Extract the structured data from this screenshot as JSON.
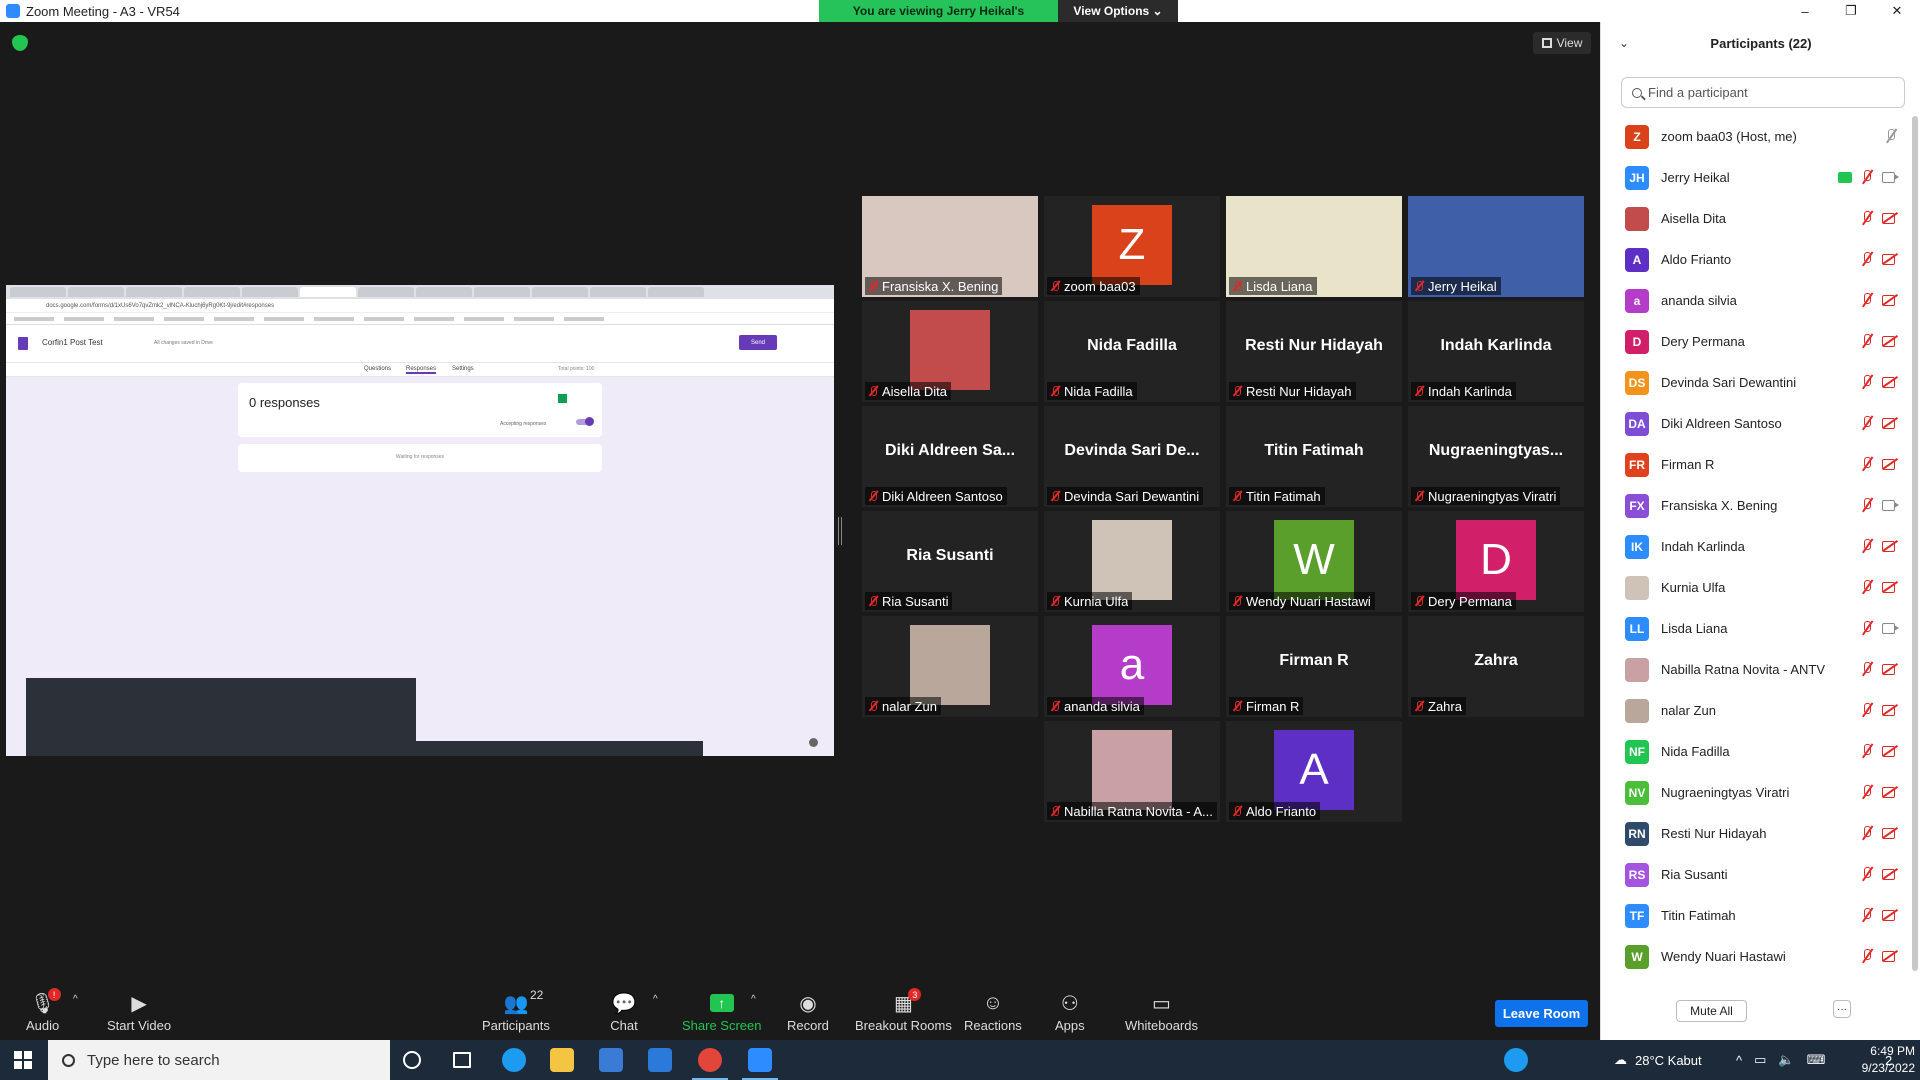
{
  "window": {
    "title": "Zoom Meeting - A3 - VR54",
    "controls": [
      "–",
      "❐",
      "✕"
    ]
  },
  "banner": {
    "viewing": "You are viewing Jerry Heikal's screen",
    "view_options": "View Options ⌄"
  },
  "view_button": "View",
  "shared_screen": {
    "url": "docs.google.com/forms/d/1xUs6Vo7qvZmk2_vlNCA-Kluchj6yRg0Kt-9j/edit#responses",
    "form_title": "Corfin1 Post Test",
    "saved_status": "All changes saved in Drive",
    "send_label": "Send",
    "tabs": [
      "Questions",
      "Responses",
      "Settings"
    ],
    "total_points": "Total points: 100",
    "responses_count": "0 responses",
    "accepting": "Accepting responses",
    "waiting": "Waiting for responses"
  },
  "gallery": [
    {
      "name": "Fransiska X. Bening",
      "display": "photo",
      "photo_color": "#d9c8c0"
    },
    {
      "name": "zoom baa03",
      "display": "avatar",
      "letter": "Z",
      "color": "#d9421a"
    },
    {
      "name": "Lisda Liana",
      "display": "photo",
      "photo_color": "#e9e3c9"
    },
    {
      "name": "Jerry Heikal",
      "display": "photo",
      "photo_color": "#3f5fa8",
      "active": true
    },
    {
      "name": "Aisella Dita",
      "display": "photo",
      "photo_color": "#c24c4c"
    },
    {
      "name": "Nida Fadilla",
      "display": "name",
      "big": "Nida Fadilla"
    },
    {
      "name": "Resti Nur Hidayah",
      "display": "name",
      "big": "Resti Nur Hidayah"
    },
    {
      "name": "Indah Karlinda",
      "display": "name",
      "big": "Indah Karlinda"
    },
    {
      "name": "Diki Aldreen Santoso",
      "display": "name",
      "big": "Diki Aldreen Sa..."
    },
    {
      "name": "Devinda Sari Dewantini",
      "display": "name",
      "big": "Devinda Sari De..."
    },
    {
      "name": "Titin Fatimah",
      "display": "name",
      "big": "Titin Fatimah"
    },
    {
      "name": "Nugraeningtyas Viratri",
      "display": "name",
      "big": "Nugraeningtyas..."
    },
    {
      "name": "Ria Susanti",
      "display": "name",
      "big": "Ria Susanti"
    },
    {
      "name": "Kurnia Ulfa",
      "display": "photo",
      "photo_color": "#cfc3b8"
    },
    {
      "name": "Wendy Nuari Hastawi",
      "display": "avatar",
      "letter": "W",
      "color": "#5a9e2c"
    },
    {
      "name": "Dery Permana",
      "display": "avatar",
      "letter": "D",
      "color": "#d11f6a"
    },
    {
      "name": "nalar Zun",
      "display": "photo",
      "photo_color": "#b8a79a"
    },
    {
      "name": "ananda silvia",
      "display": "avatar",
      "letter": "a",
      "color": "#b53cc8"
    },
    {
      "name": "Firman R",
      "display": "name",
      "big": "Firman R"
    },
    {
      "name": "Zahra",
      "display": "name",
      "big": "Zahra"
    },
    {
      "name": "Nabilla Ratna Novita - A...",
      "display": "photo",
      "photo_color": "#c9a0a4"
    },
    {
      "name": "Aldo Frianto",
      "display": "avatar",
      "letter": "A",
      "color": "#5e2fc4"
    }
  ],
  "toolbar": {
    "audio": "Audio",
    "start_video": "Start Video",
    "participants": "Participants",
    "participants_count": "22",
    "chat": "Chat",
    "share_screen": "Share Screen",
    "record": "Record",
    "breakout_rooms": "Breakout Rooms",
    "breakout_badge": "3",
    "reactions": "Reactions",
    "apps": "Apps",
    "whiteboards": "Whiteboards",
    "audio_badge": "!",
    "leave": "Leave Room"
  },
  "panel": {
    "title": "Participants (22)",
    "search_placeholder": "Find a participant",
    "mute_all": "Mute All",
    "more": "···",
    "participants": [
      {
        "initials": "Z",
        "name": "zoom baa03 (Host, me)",
        "color": "#d9421a",
        "mic": "off",
        "cam": "none"
      },
      {
        "initials": "JH",
        "name": "Jerry Heikal",
        "color": "#2d8cff",
        "mic": "off",
        "cam": "on",
        "sharing": true
      },
      {
        "initials": "",
        "name": "Aisella Dita",
        "color": "#c24c4c",
        "mic": "off",
        "cam": "off"
      },
      {
        "initials": "A",
        "name": "Aldo Frianto",
        "color": "#5e2fc4",
        "mic": "off",
        "cam": "off"
      },
      {
        "initials": "a",
        "name": "ananda silvia",
        "color": "#b53cc8",
        "mic": "off",
        "cam": "off"
      },
      {
        "initials": "D",
        "name": "Dery Permana",
        "color": "#d11f6a",
        "mic": "off",
        "cam": "off"
      },
      {
        "initials": "DS",
        "name": "Devinda Sari Dewantini",
        "color": "#f2941c",
        "mic": "off",
        "cam": "off"
      },
      {
        "initials": "DA",
        "name": "Diki Aldreen Santoso",
        "color": "#7e4dd6",
        "mic": "off",
        "cam": "off"
      },
      {
        "initials": "FR",
        "name": "Firman R",
        "color": "#e0421f",
        "mic": "off",
        "cam": "off"
      },
      {
        "initials": "FX",
        "name": "Fransiska X. Bening",
        "color": "#8a4fd6",
        "mic": "off",
        "cam": "on"
      },
      {
        "initials": "IK",
        "name": "Indah Karlinda",
        "color": "#2d8cff",
        "mic": "off",
        "cam": "off"
      },
      {
        "initials": "",
        "name": "Kurnia Ulfa",
        "color": "#cfc3b8",
        "mic": "off",
        "cam": "off"
      },
      {
        "initials": "LL",
        "name": "Lisda Liana",
        "color": "#2d8cff",
        "mic": "off",
        "cam": "on"
      },
      {
        "initials": "",
        "name": "Nabilla Ratna Novita - ANTV",
        "color": "#c9a0a4",
        "mic": "off",
        "cam": "off"
      },
      {
        "initials": "",
        "name": "nalar Zun",
        "color": "#b8a79a",
        "mic": "off",
        "cam": "off"
      },
      {
        "initials": "NF",
        "name": "Nida Fadilla",
        "color": "#23c552",
        "mic": "off",
        "cam": "off"
      },
      {
        "initials": "NV",
        "name": "Nugraeningtyas Viratri",
        "color": "#4cbf3a",
        "mic": "off",
        "cam": "off"
      },
      {
        "initials": "RN",
        "name": "Resti Nur Hidayah",
        "color": "#2f4a6b",
        "mic": "off",
        "cam": "off"
      },
      {
        "initials": "RS",
        "name": "Ria Susanti",
        "color": "#a455e0",
        "mic": "off",
        "cam": "off"
      },
      {
        "initials": "TF",
        "name": "Titin Fatimah",
        "color": "#2d8cff",
        "mic": "off",
        "cam": "off"
      },
      {
        "initials": "W",
        "name": "Wendy Nuari Hastawi",
        "color": "#5a9e2c",
        "mic": "off",
        "cam": "off"
      }
    ]
  },
  "taskbar": {
    "search_placeholder": "Type here to search",
    "weather": "28°C  Kabut",
    "time": "6:49 PM",
    "date": "9/23/2022",
    "notifications": "2"
  }
}
